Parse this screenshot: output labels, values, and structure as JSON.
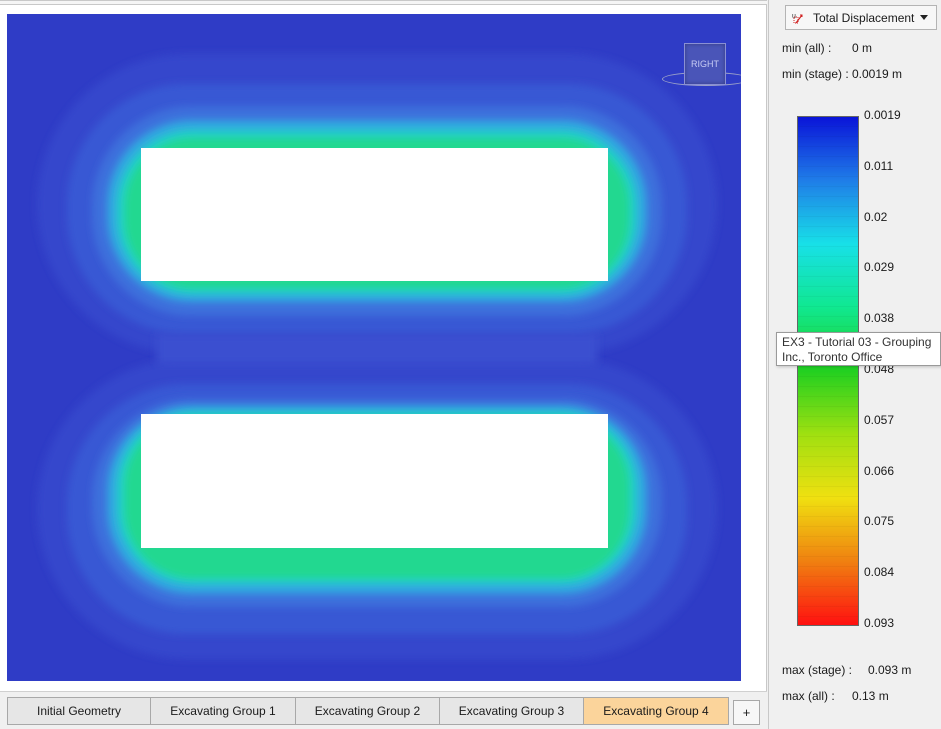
{
  "stages": {
    "tabs": [
      {
        "label": "Initial Geometry",
        "active": false
      },
      {
        "label": "Excavating Group 1",
        "active": false
      },
      {
        "label": "Excavating Group 2",
        "active": false
      },
      {
        "label": "Excavating Group 3",
        "active": false
      },
      {
        "label": "Excavating Group 4",
        "active": true
      }
    ],
    "add_label": "+"
  },
  "view_cube": {
    "label": "RIGHT"
  },
  "legend": {
    "result_type": "Total Displacement",
    "result_icon": "displacement-icon",
    "min_all_label": "min (all) :",
    "min_all_value": "0 m",
    "min_stage_label": "min (stage) :",
    "min_stage_value": "0.0019 m",
    "max_stage_label": "max (stage) :",
    "max_stage_value": "0.093 m",
    "max_all_label": "max (all) :",
    "max_all_value": "0.13 m",
    "ticks": [
      "0.0019",
      "0.011",
      "0.02",
      "0.029",
      "0.038",
      "0.048",
      "0.057",
      "0.066",
      "0.075",
      "0.084",
      "0.093"
    ]
  },
  "tooltip": {
    "line1": "EX3 - Tutorial 03 - Grouping",
    "line2": "Inc., Toronto Office"
  },
  "colors": {
    "background_contour": "#2f3cc6",
    "active_tab": "#fbd49b",
    "colorbar_stops": [
      "#0a14d8",
      "#1f7de8",
      "#18e0e8",
      "#10e890",
      "#22d020",
      "#a0e010",
      "#f0e010",
      "#f08010",
      "#ff1010"
    ]
  }
}
